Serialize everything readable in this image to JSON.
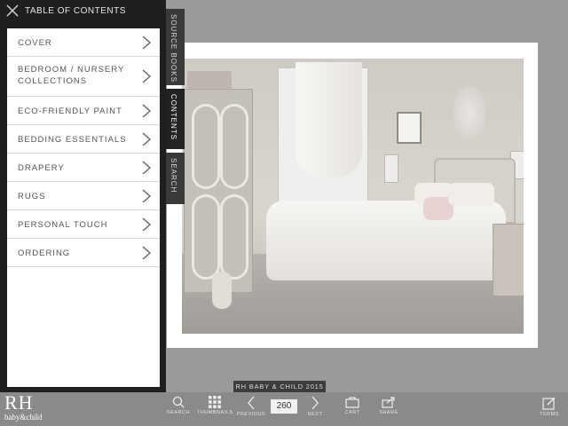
{
  "toc": {
    "title": "TABLE OF CONTENTS",
    "items": [
      {
        "label": "COVER"
      },
      {
        "label": "BEDROOM / NURSERY COLLECTIONS"
      },
      {
        "label": "ECO-FRIENDLY PAINT"
      },
      {
        "label": "BEDDING ESSENTIALS"
      },
      {
        "label": "DRAPERY"
      },
      {
        "label": "RUGS"
      },
      {
        "label": "PERSONAL TOUCH"
      },
      {
        "label": "ORDERING"
      }
    ]
  },
  "side_tabs": {
    "source_books": "SOURCE BOOKS",
    "contents": "CONTENTS",
    "search": "SEARCH"
  },
  "catalog": {
    "issue": "RH BABY & CHILD 2015"
  },
  "logo": {
    "mark": "RH",
    "sub": "baby&child"
  },
  "toolbar": {
    "search": "SEARCH",
    "thumbnails": "THUMBNAILS",
    "previous": "PREVIOUS",
    "page_number": "260",
    "next": "NEXT",
    "cart": "CART",
    "share": "SHARE",
    "terms": "TERMS"
  },
  "colors": {
    "panel_bg": "#1f1f1f",
    "toolbar_bg": "#8a8a8a",
    "background": "#9a9a9a"
  },
  "icons": [
    "close-icon",
    "chevron-right-icon",
    "search-icon",
    "grid-icon",
    "chevron-left-icon",
    "bag-icon",
    "share-icon",
    "edit-icon"
  ]
}
